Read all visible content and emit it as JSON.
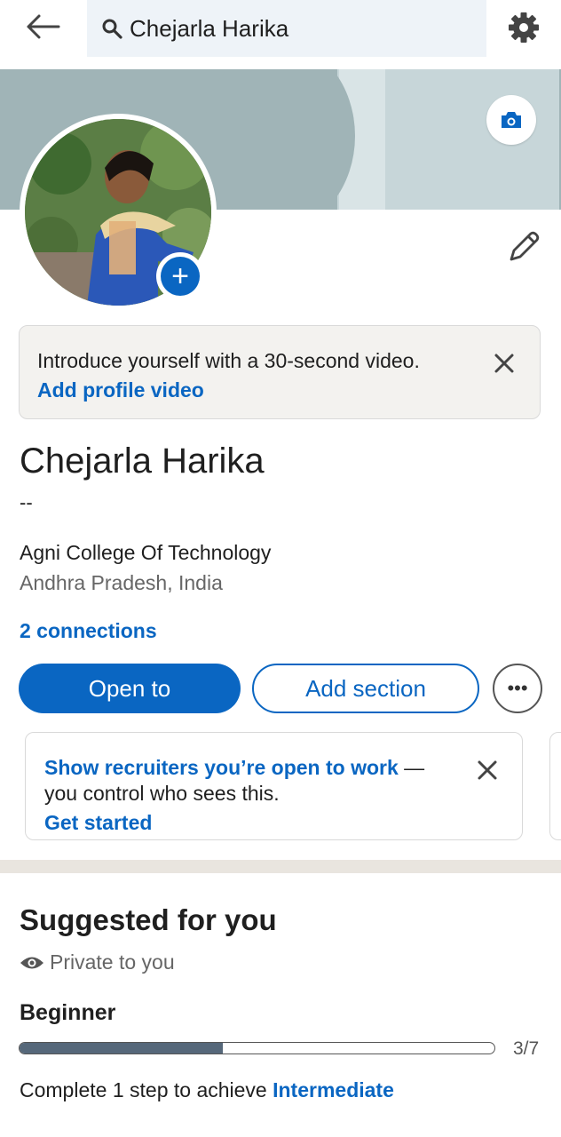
{
  "header": {
    "search_value": "Chejarla Harika",
    "icons": [
      "back-arrow-icon",
      "search-icon",
      "gear-icon"
    ]
  },
  "profile": {
    "name": "Chejarla Harika",
    "headline": "--",
    "college": "Agni College Of Technology",
    "location": "Andhra Pradesh, India",
    "connections": "2 connections"
  },
  "video_prompt": {
    "text": "Introduce yourself with a 30-second video.",
    "link": "Add profile video"
  },
  "actions": {
    "open_to": "Open to",
    "add_section": "Add section",
    "more": "•••"
  },
  "recruiter_card": {
    "highlight": "Show recruiters you’re open to work",
    "rest": " —",
    "line2": "you control who sees this.",
    "link": "Get started"
  },
  "suggested": {
    "title": "Suggested for you",
    "privacy": "Private to you",
    "level": "Beginner",
    "progress_text": "3/7",
    "progress_fraction": 0.4286,
    "complete_prefix": "Complete 1 step to achieve ",
    "complete_target": "Intermediate"
  },
  "colors": {
    "accent": "#0a66c2",
    "banner": "#a0b4b7",
    "progress_fill": "#56687a"
  }
}
